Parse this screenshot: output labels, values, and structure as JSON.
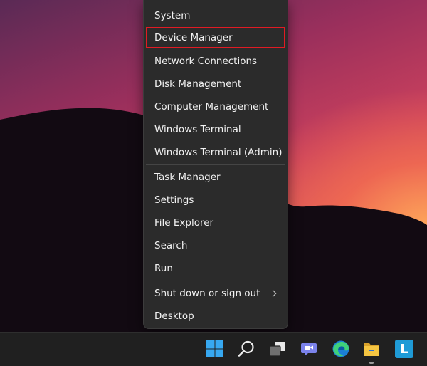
{
  "context_menu": {
    "items": [
      {
        "label": "System"
      },
      {
        "label": "Device Manager",
        "highlighted": true
      },
      {
        "label": "Network Connections"
      },
      {
        "label": "Disk Management"
      },
      {
        "label": "Computer Management"
      },
      {
        "label": "Windows Terminal"
      },
      {
        "label": "Windows Terminal (Admin)"
      },
      {
        "label": "Task Manager"
      },
      {
        "label": "Settings"
      },
      {
        "label": "File Explorer"
      },
      {
        "label": "Search"
      },
      {
        "label": "Run"
      },
      {
        "label": "Shut down or sign out",
        "has_submenu": true
      },
      {
        "label": "Desktop"
      }
    ],
    "highlight_color": "#e01b24"
  },
  "taskbar": {
    "icons": [
      "windows-start-icon",
      "search-icon",
      "task-view-icon",
      "teams-chat-icon",
      "edge-icon",
      "file-explorer-icon",
      "app-l-icon"
    ],
    "app_l_letter": "L"
  }
}
